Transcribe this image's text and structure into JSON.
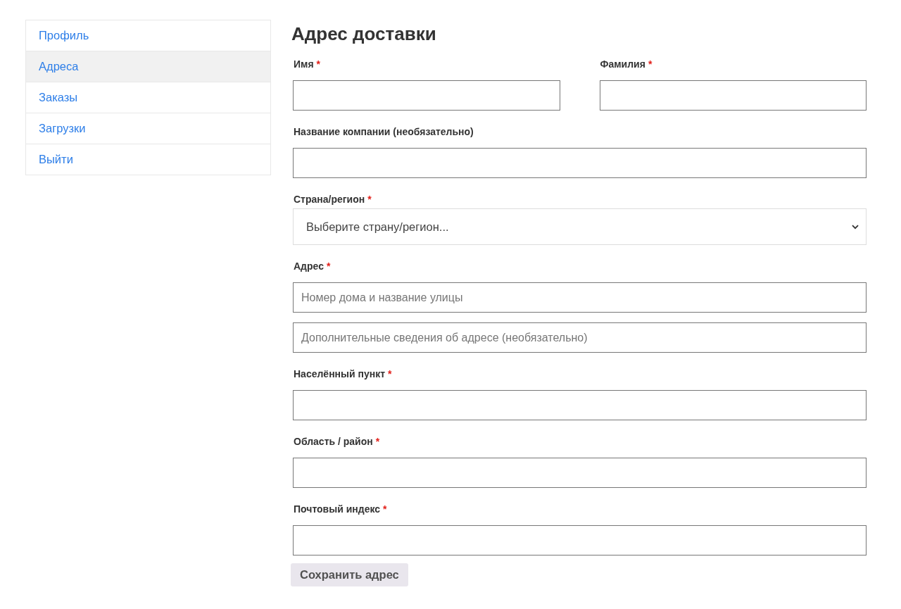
{
  "sidebar": {
    "items": [
      {
        "label": "Профиль",
        "selected": false
      },
      {
        "label": "Адреса",
        "selected": true
      },
      {
        "label": "Заказы",
        "selected": false
      },
      {
        "label": "Загрузки",
        "selected": false
      },
      {
        "label": "Выйти",
        "selected": false
      }
    ]
  },
  "form": {
    "title": "Адрес доставки",
    "rows": [
      [
        {
          "kind": "text",
          "label": "Имя",
          "required_mark": "*"
        },
        {
          "kind": "text",
          "label": "Фамилия",
          "required_mark": "*"
        }
      ],
      [
        {
          "kind": "text",
          "label": "Название компании (необязательно)"
        }
      ],
      [
        {
          "kind": "select",
          "label": "Страна/регион",
          "required_mark": "*",
          "value": "Выберите страну/регион..."
        }
      ],
      [
        {
          "kind": "text",
          "label": "Адрес",
          "required_mark": "*",
          "placeholders": [
            "Номер дома и название улицы",
            "Дополнительные сведения об адресе (необязательно)"
          ]
        }
      ],
      [
        {
          "kind": "text",
          "label": "Населённый пункт",
          "required_mark": "*"
        }
      ],
      [
        {
          "kind": "text",
          "label": "Область / район",
          "required_mark": "*"
        }
      ],
      [
        {
          "kind": "text",
          "label": "Почтовый индекс",
          "required_mark": "*"
        }
      ]
    ],
    "submit": "Сохранить адрес"
  }
}
